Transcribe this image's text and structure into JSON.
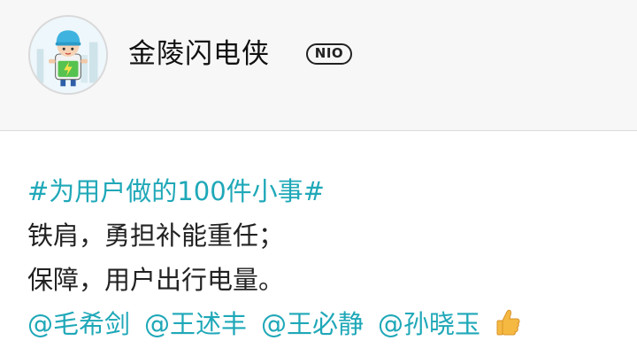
{
  "header": {
    "username": "金陵闪电侠",
    "badge": "NIO",
    "avatar_icon": "cartoon-mascot-avatar"
  },
  "post": {
    "hashtag": "#为用户做的100件小事#",
    "lines": [
      "铁肩，勇担补能重任；",
      "保障，用户出行电量。"
    ],
    "mentions": [
      "@毛希剑",
      "@王述丰",
      "@王必静",
      "@孙晓玉"
    ],
    "emoji": "thumbs-up-icon"
  },
  "colors": {
    "accent": "#1fa8b8",
    "header_bg": "#f7f7f7",
    "text": "#222222"
  }
}
